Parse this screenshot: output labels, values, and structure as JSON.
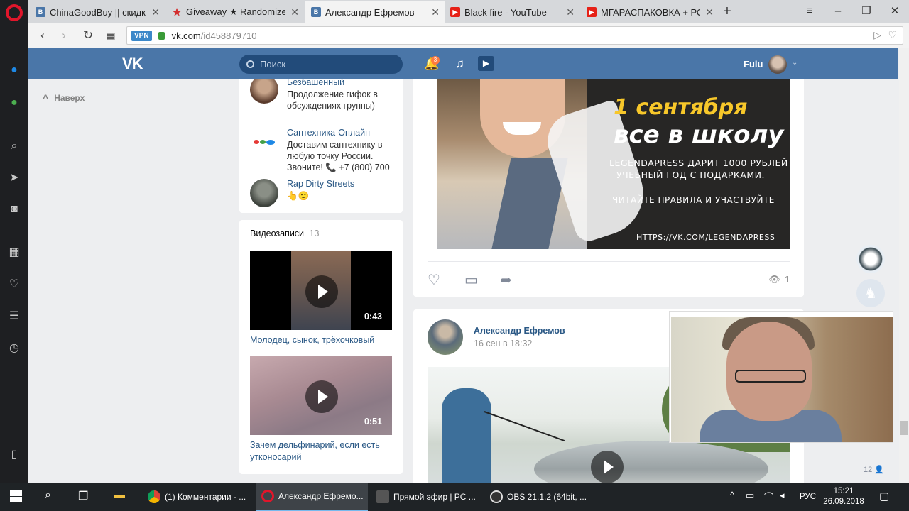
{
  "browser": {
    "tabs": [
      {
        "title": "ChinaGoodBuy || скидки/",
        "favicon": "vk-icon",
        "color": "#4a76a8",
        "active": false
      },
      {
        "title": "Giveaway ★ Randomizer f",
        "favicon": "star-icon",
        "color": "#d32f2f",
        "active": false
      },
      {
        "title": "Александр Ефремов",
        "favicon": "vk-icon",
        "color": "#4a76a8",
        "active": true
      },
      {
        "title": "Black fire - YouTube",
        "favicon": "youtube-icon",
        "color": "#e62117",
        "active": false
      },
      {
        "title": "МГАРАСПАКОВКА + РОЗ",
        "favicon": "youtube-icon",
        "color": "#e62117",
        "active": false
      }
    ],
    "vpn_label": "VPN",
    "url_host": "vk.com",
    "url_path": "/id458879710"
  },
  "vk": {
    "search_placeholder": "Поиск",
    "notifications_count": "3",
    "user_name": "Fulu",
    "scroll_top_label": "Наверх"
  },
  "communities": [
    {
      "name": "Безбашенный",
      "desc": "Продолжение гифок в обсуждениях группы)"
    },
    {
      "name": "Сантехника-Онлайн",
      "desc": "Доставим сантехнику в любую точку России. Звоните! 📞 +7 (800) 700"
    },
    {
      "name": "Rap Dirty Streets",
      "desc": "👆🙂"
    }
  ],
  "videos": {
    "header": "Видеозаписи",
    "count": "13",
    "items": [
      {
        "title": "Молодец, сынок, трёхочковый",
        "duration": "0:43"
      },
      {
        "title": "Зачем дельфинарий, если есть утконосарий",
        "duration": "0:51"
      }
    ]
  },
  "post1": {
    "promo": {
      "date": "1 сентября",
      "school": "все в школу",
      "line1": "LEGENDAPRESS ДАРИТ 1000 РУБЛЕЙ",
      "line2": "УЧЕБНЫЙ ГОД С ПОДАРКАМИ.",
      "line3": "ЧИТАЙТЕ ПРАВИЛА И УЧАСТВУЙТЕ",
      "url": "HTTPS://VK.COM/LEGENDAPRESS"
    },
    "views": "1"
  },
  "post2": {
    "author": "Александр Ефремов",
    "date": "16 сен в 18:32"
  },
  "online_count": "12",
  "taskbar": {
    "apps": [
      {
        "title": "(1) Комментарии - ...",
        "icon": "chrome-icon",
        "color": "#4caf50",
        "active": false
      },
      {
        "title": "Александр Ефремо...",
        "icon": "opera-icon",
        "color": "#e0162b",
        "active": true
      },
      {
        "title": "Прямой эфир | PC ...",
        "icon": "clapper-icon",
        "color": "#555555",
        "active": false
      },
      {
        "title": "OBS 21.1.2 (64bit, ...",
        "icon": "obs-icon",
        "color": "#333333",
        "active": false
      }
    ],
    "language": "РУС",
    "time": "15:21",
    "date": "26.09.2018"
  }
}
